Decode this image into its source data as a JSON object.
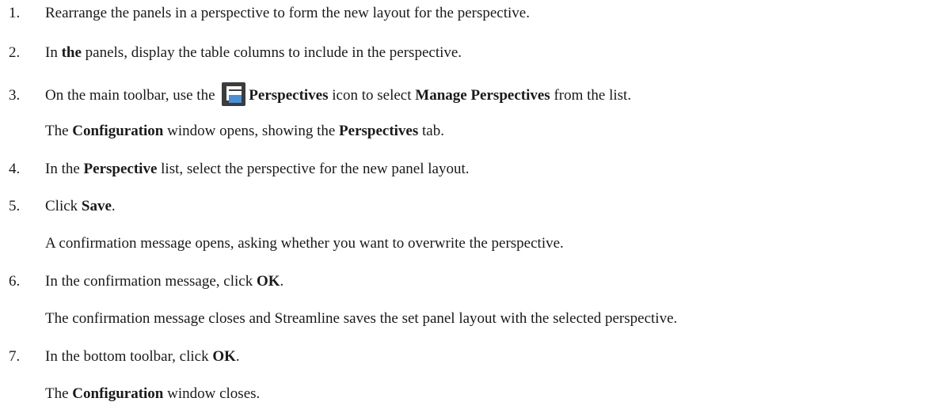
{
  "steps": [
    {
      "num": "1.",
      "text": "Rearrange the panels in a perspective to form the new layout for the perspective."
    },
    {
      "num": "2.",
      "pre": "In ",
      "bold": "the",
      "post": " panels, display the table columns to include in the perspective."
    },
    {
      "num": "3.",
      "pre": "On the main toolbar, use the ",
      "icon": "perspectives-icon",
      "bold1": "Perspectives",
      "mid": " icon to select ",
      "bold2": "Manage Perspectives",
      "post": " from the list.",
      "note": {
        "pre": "The ",
        "bold1": "Configuration",
        "mid": " window opens, showing the ",
        "bold2": "Perspectives",
        "post": " tab."
      }
    },
    {
      "num": "4.",
      "pre": "In the ",
      "bold": "Perspective",
      "post": " list, select the perspective for the new panel layout."
    },
    {
      "num": "5.",
      "pre": "Click ",
      "bold": "Save",
      "post": ".",
      "note": {
        "text": "A confirmation message opens, asking whether you want to overwrite the perspective."
      }
    },
    {
      "num": "6.",
      "pre": "In the confirmation message, click ",
      "bold": "OK",
      "post": ".",
      "note": {
        "text": "The confirmation message closes and Streamline saves the set panel layout with the selected perspective."
      }
    },
    {
      "num": "7.",
      "pre": "In the bottom toolbar, click ",
      "bold": "OK",
      "post": ".",
      "note": {
        "pre": "The ",
        "bold": "Configuration",
        "post": " window closes."
      }
    }
  ],
  "colors": {
    "text": "#1a1a1a",
    "icon_bg": "#3c3c3c",
    "icon_window": "#4a90d9"
  }
}
